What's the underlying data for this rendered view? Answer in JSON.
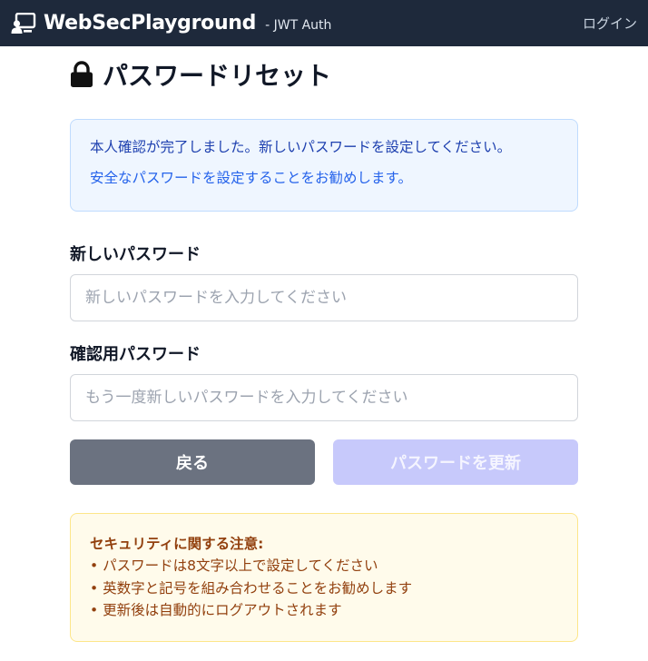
{
  "navbar": {
    "brand_name": "WebSecPlayground",
    "brand_sub": "- JWT Auth",
    "login_link": "ログイン"
  },
  "page": {
    "title": "パスワードリセット"
  },
  "info": {
    "line1": "本人確認が完了しました。新しいパスワードを設定してください。",
    "line2": "安全なパスワードを設定することをお勧めします。"
  },
  "form": {
    "new_password_label": "新しいパスワード",
    "new_password_placeholder": "新しいパスワードを入力してください",
    "new_password_value": "",
    "confirm_password_label": "確認用パスワード",
    "confirm_password_placeholder": "もう一度新しいパスワードを入力してください",
    "confirm_password_value": "",
    "back_button": "戻る",
    "update_button": "パスワードを更新"
  },
  "notes": {
    "title": "セキュリティに関する注意:",
    "items": [
      "パスワードは8文字以上で設定してください",
      "英数字と記号を組み合わせることをお勧めします",
      "更新後は自動的にログアウトされます"
    ]
  },
  "colors": {
    "navbar_bg": "#1e293b",
    "info_bg": "#eff6ff",
    "warn_bg": "#fffbeb",
    "back_button_bg": "#6b7280",
    "update_button_bg": "#c7c9fb"
  },
  "icons": {
    "brand": "user-presentation-icon",
    "title": "lock-icon"
  }
}
